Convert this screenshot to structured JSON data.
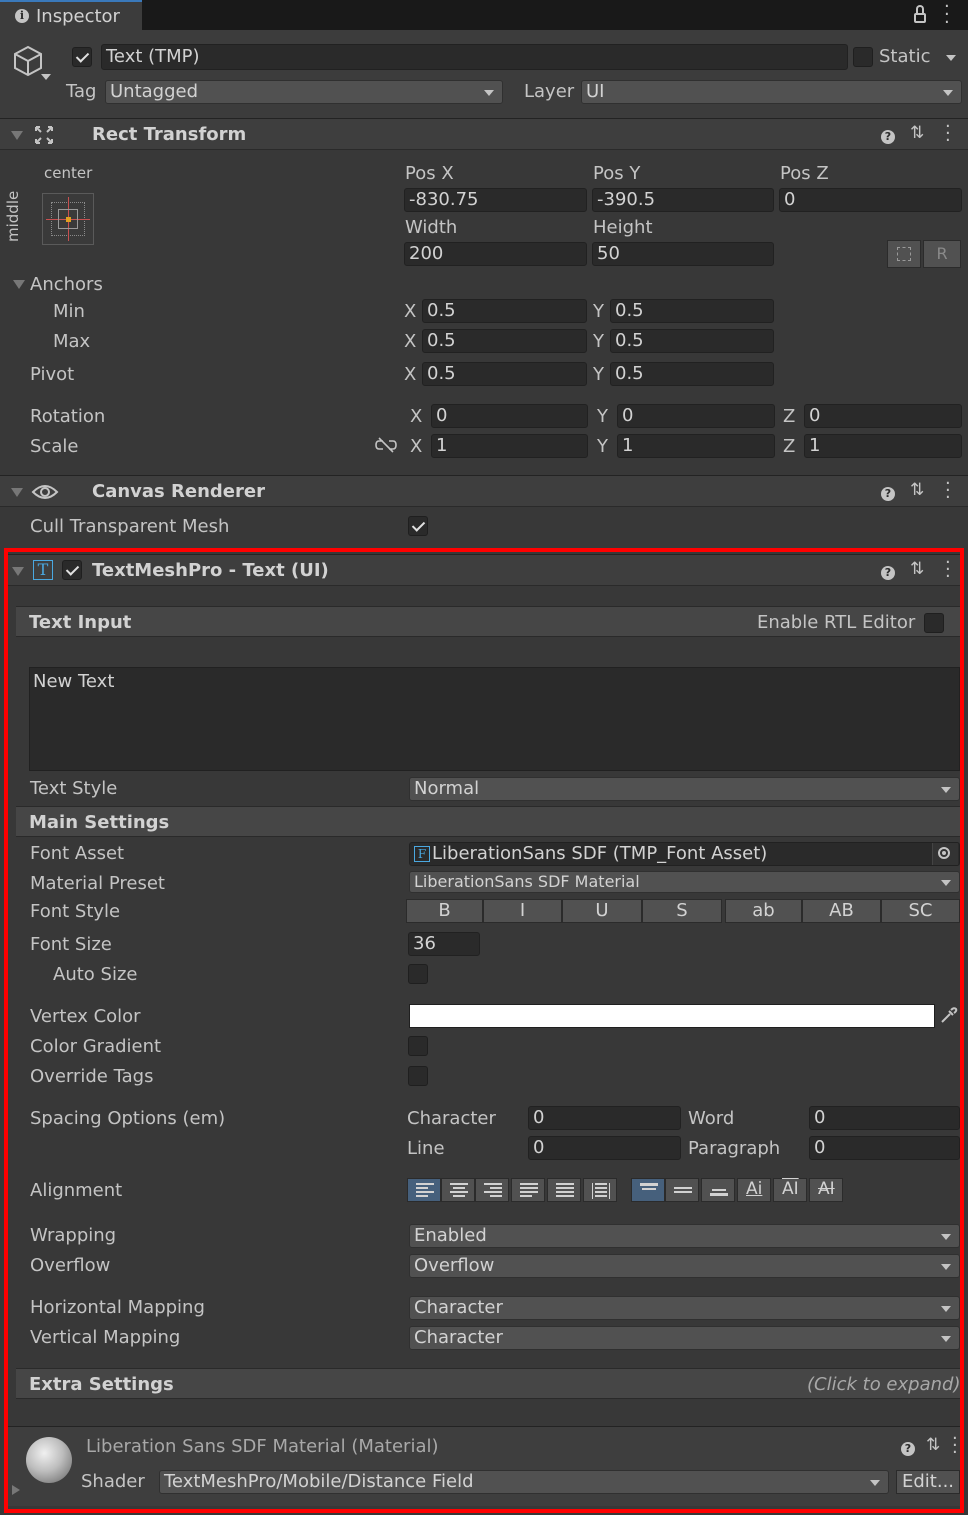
{
  "tab": {
    "title": "Inspector"
  },
  "object": {
    "name": "Text (TMP)",
    "static_label": "Static",
    "tag_label": "Tag",
    "tag_value": "Untagged",
    "layer_label": "Layer",
    "layer_value": "UI"
  },
  "rect_transform": {
    "title": "Rect Transform",
    "anchor_h": "center",
    "anchor_v": "middle",
    "pos_x_label": "Pos X",
    "pos_x": "-830.75",
    "pos_y_label": "Pos Y",
    "pos_y": "-390.5",
    "pos_z_label": "Pos Z",
    "pos_z": "0",
    "width_label": "Width",
    "width": "200",
    "height_label": "Height",
    "height": "50",
    "raw_button": "R",
    "anchors_label": "Anchors",
    "min_label": "Min",
    "min_x": "0.5",
    "min_y": "0.5",
    "max_label": "Max",
    "max_x": "0.5",
    "max_y": "0.5",
    "pivot_label": "Pivot",
    "pivot_x": "0.5",
    "pivot_y": "0.5",
    "rotation_label": "Rotation",
    "rot_x": "0",
    "rot_y": "0",
    "rot_z": "0",
    "scale_label": "Scale",
    "scale_x": "1",
    "scale_y": "1",
    "scale_z": "1",
    "x": "X",
    "y": "Y",
    "z": "Z"
  },
  "canvas_renderer": {
    "title": "Canvas Renderer",
    "cull_label": "Cull Transparent Mesh"
  },
  "tmp": {
    "title": "TextMeshPro - Text (UI)",
    "text_input": {
      "title": "Text Input",
      "rtl_label": "Enable RTL Editor",
      "text": "New Text"
    },
    "text_style_label": "Text Style",
    "text_style_value": "Normal",
    "main_settings": {
      "title": "Main Settings",
      "font_asset_label": "Font Asset",
      "font_asset_value": "LiberationSans SDF (TMP_Font Asset)",
      "material_preset_label": "Material Preset",
      "material_preset_value": "LiberationSans SDF Material",
      "font_style_label": "Font Style",
      "font_style_buttons": [
        "B",
        "I",
        "U",
        "S",
        "ab",
        "AB",
        "SC"
      ],
      "font_size_label": "Font Size",
      "font_size_value": "36",
      "auto_size_label": "Auto Size",
      "vertex_color_label": "Vertex Color",
      "vertex_color": "#ffffff",
      "color_gradient_label": "Color Gradient",
      "override_tags_label": "Override Tags",
      "spacing_label": "Spacing Options (em)",
      "character_label": "Character",
      "character_value": "0",
      "word_label": "Word",
      "word_value": "0",
      "line_label": "Line",
      "line_value": "0",
      "paragraph_label": "Paragraph",
      "paragraph_value": "0",
      "alignment_label": "Alignment",
      "wrapping_label": "Wrapping",
      "wrapping_value": "Enabled",
      "overflow_label": "Overflow",
      "overflow_value": "Overflow",
      "hmap_label": "Horizontal Mapping",
      "hmap_value": "Character",
      "vmap_label": "Vertical Mapping",
      "vmap_value": "Character"
    },
    "extra_settings": {
      "title": "Extra Settings",
      "hint": "(Click to expand)"
    }
  },
  "material": {
    "title": "Liberation Sans SDF Material (Material)",
    "shader_label": "Shader",
    "shader_value": "TextMeshPro/Mobile/Distance Field",
    "edit_button": "Edit..."
  },
  "colors": {
    "highlight": "#ff0000",
    "accent": "#3a79bb"
  }
}
